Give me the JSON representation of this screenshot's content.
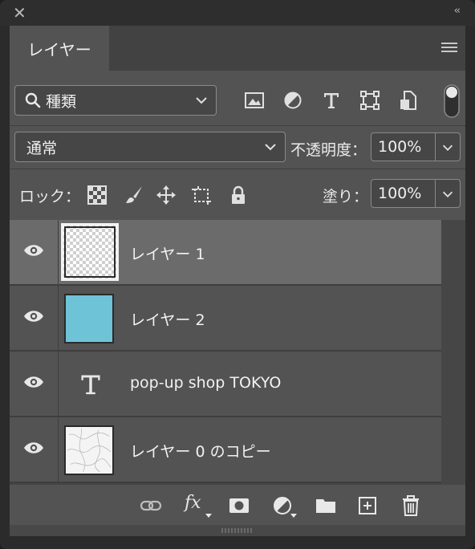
{
  "window": {
    "close_glyph": "✕",
    "collapse_glyph": "‹‹"
  },
  "tab": {
    "label": "レイヤー"
  },
  "filter": {
    "kind_label": "種類",
    "icons": [
      "image-filter-icon",
      "adjustment-filter-icon",
      "type-filter-icon",
      "shape-filter-icon",
      "smart-object-filter-icon"
    ],
    "toggle": "filter-toggle"
  },
  "blend": {
    "mode": "通常",
    "opacity_label": "不透明度：",
    "opacity_value": "100%"
  },
  "lock": {
    "label": "ロック：",
    "icons": [
      "lock-transparent-icon",
      "lock-image-icon",
      "lock-position-icon",
      "lock-artboard-icon",
      "lock-all-icon"
    ],
    "fill_label": "塗り：",
    "fill_value": "100%"
  },
  "layers": [
    {
      "name": "レイヤー 1",
      "thumb": "checker-text",
      "selected": true,
      "visible": true
    },
    {
      "name": "レイヤー 2",
      "thumb": "color",
      "thumb_color": "#6ec3d6",
      "selected": false,
      "visible": true
    },
    {
      "name": "pop-up shop TOKYO",
      "thumb": "type",
      "thumb_glyph": "T",
      "selected": false,
      "visible": true
    },
    {
      "name": "レイヤー 0 のコピー",
      "thumb": "marble",
      "selected": false,
      "visible": true
    }
  ],
  "footer": {
    "icons": [
      "link-icon",
      "fx-icon",
      "mask-icon",
      "adjustment-layer-icon",
      "group-folder-icon",
      "new-layer-icon",
      "trash-icon"
    ],
    "fx_text": "fx"
  }
}
